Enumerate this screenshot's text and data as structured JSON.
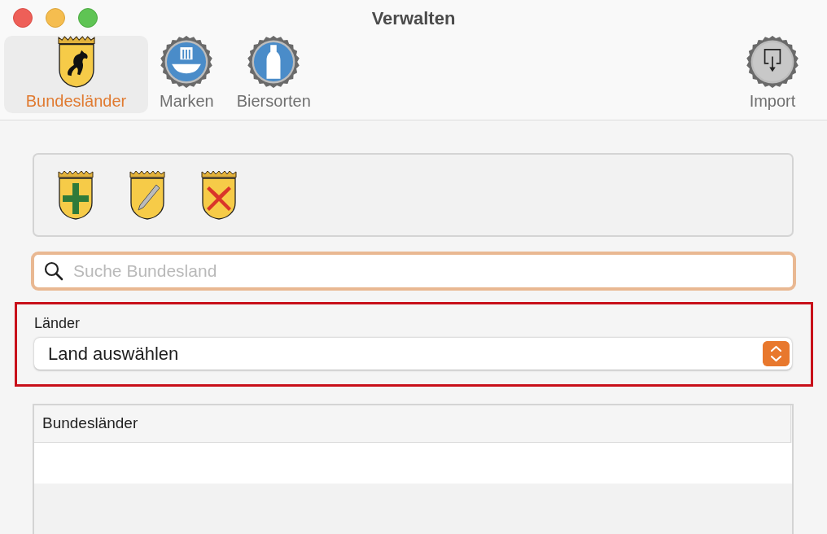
{
  "window": {
    "title": "Verwalten"
  },
  "toolbar": [
    {
      "label": "Bundesländer",
      "kind": "shield",
      "selected": true
    },
    {
      "label": "Marken",
      "kind": "cap-letter",
      "selected": false
    },
    {
      "label": "Biersorten",
      "kind": "cap-bottle",
      "selected": false
    },
    {
      "label": "Import",
      "kind": "cap-import",
      "selected": false
    }
  ],
  "actions": [
    {
      "kind": "add"
    },
    {
      "kind": "edit"
    },
    {
      "kind": "delete"
    }
  ],
  "search": {
    "placeholder": "Suche Bundesland"
  },
  "country_picker": {
    "label": "Länder",
    "value": "Land auswählen"
  },
  "table": {
    "columns": [
      "Bundesländer"
    ]
  }
}
